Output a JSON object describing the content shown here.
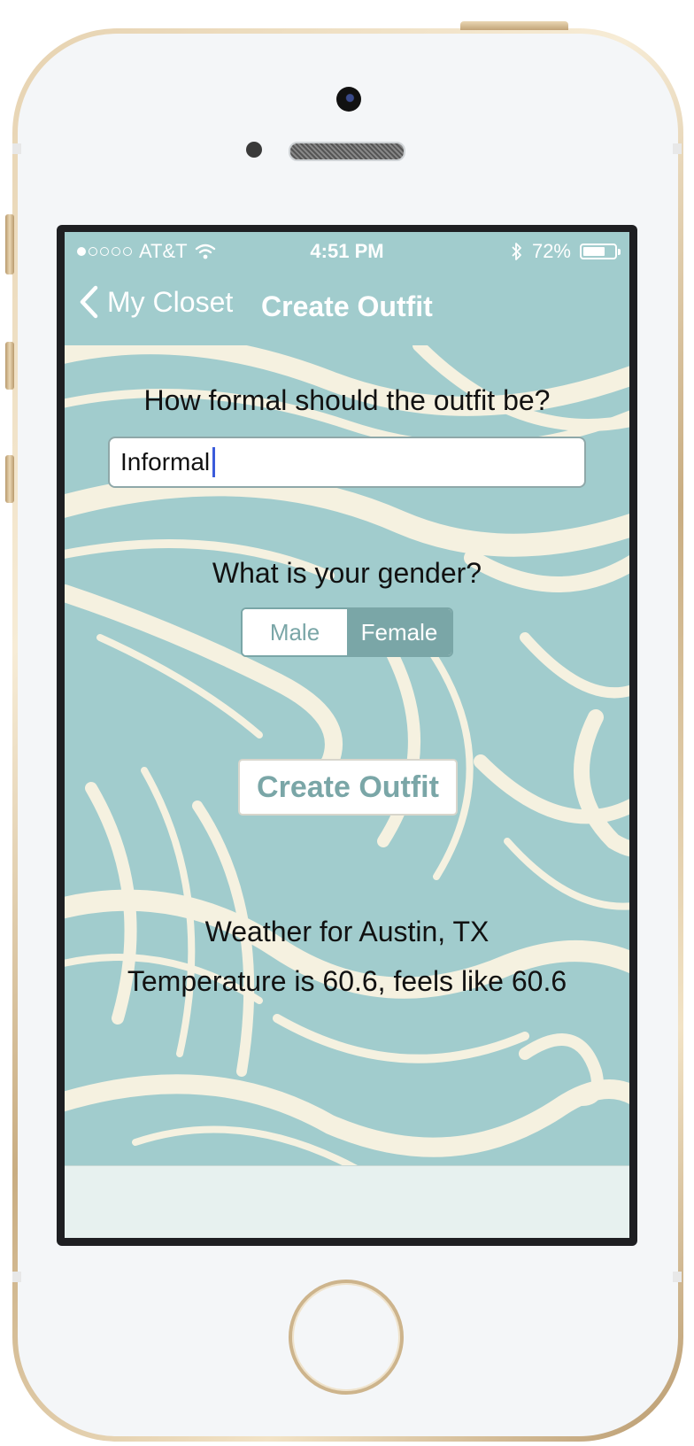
{
  "status_bar": {
    "carrier": "AT&T",
    "time": "4:51 PM",
    "battery": "72%",
    "battery_level": 0.72,
    "signal_bars": 1
  },
  "nav": {
    "back_label": "My Closet",
    "title": "Create Outfit"
  },
  "form": {
    "formality_question": "How formal should the outfit be?",
    "formality_value": "Informal",
    "gender_question": "What is your gender?",
    "gender_options": [
      "Male",
      "Female"
    ],
    "gender_selected": "Female",
    "create_button": "Create Outfit"
  },
  "weather": {
    "location_line": "Weather for Austin, TX",
    "temperature_line": "Temperature is 60.6, feels like 60.6"
  },
  "colors": {
    "teal_background": "#a1cccd",
    "accent_teal": "#7aa6a7",
    "wave_cream": "#f5f1e0"
  },
  "icons": [
    "back-chevron-icon",
    "wifi-icon",
    "bluetooth-icon",
    "battery-icon"
  ]
}
